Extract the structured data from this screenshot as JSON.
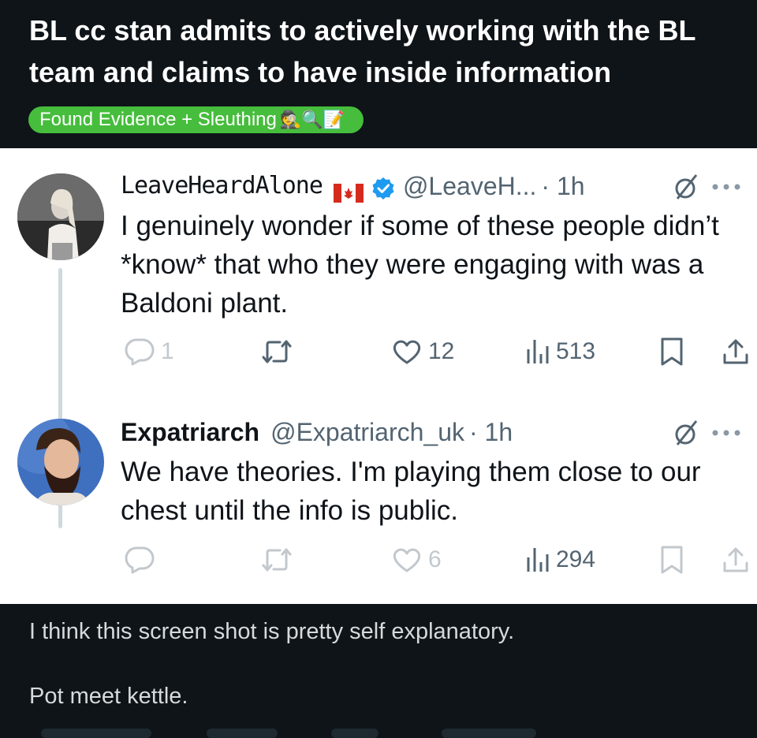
{
  "post": {
    "title": "BL cc stan admits to actively working with the BL team and claims to have inside information",
    "flair": {
      "label": "Found Evidence + Sleuthing",
      "emojis": "🕵️🔍📝",
      "color": "#46bd3c"
    },
    "body": [
      "I think this screen shot is pretty self explanatory.",
      "Pot meet kettle."
    ]
  },
  "tweets": [
    {
      "name": "LeaveHeardAlone",
      "handle": "@LeaveH...",
      "time": "· 1h",
      "has_flag": true,
      "verified": true,
      "text": "I genuinely wonder if some of these people didn’t *know* that who they were engaging with was a Baldoni plant.",
      "replies": "1",
      "likes": "12",
      "views": "513",
      "avatar_icon": "woman-photo-avatar"
    },
    {
      "name": "Expatriarch",
      "handle": "@Expatriarch_uk",
      "time": "· 1h",
      "has_flag": false,
      "verified": false,
      "text": "We have theories. I'm playing them close to our chest until the info is public.",
      "replies": "",
      "likes": "6",
      "views": "294",
      "avatar_icon": "bearded-man-avatar"
    }
  ],
  "colors": {
    "page_bg": "#0e1418",
    "shot_bg": "#ffffff",
    "verified_blue": "#1d9bf0",
    "muted": "#536471"
  }
}
